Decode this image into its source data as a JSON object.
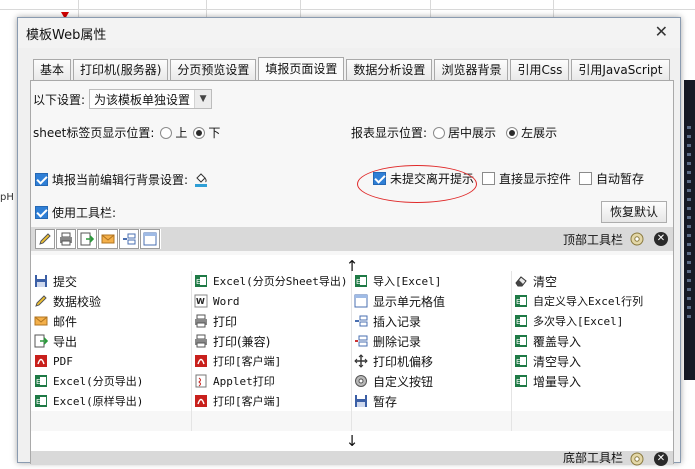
{
  "background": {
    "cell_mark": "pH ·"
  },
  "dialog": {
    "title": "模板Web属性",
    "close_label": "✕",
    "tabs": [
      {
        "label": "基本"
      },
      {
        "label": "打印机(服务器)"
      },
      {
        "label": "分页预览设置"
      },
      {
        "label": "填报页面设置",
        "active": true
      },
      {
        "label": "数据分析设置"
      },
      {
        "label": "浏览器背景"
      },
      {
        "label": "引用Css"
      },
      {
        "label": "引用JavaScript"
      }
    ]
  },
  "settings": {
    "scope_label": "以下设置:",
    "scope_value": "为该模板单独设置",
    "sheet_tab_label": "sheet标签页显示位置:",
    "sheet_opt_top": "上",
    "sheet_opt_bottom": "下",
    "report_pos_label": "报表显示位置:",
    "report_opt_center": "居中展示",
    "report_opt_left": "左展示",
    "fill_row_bg_label": "填报当前编辑行背景设置:",
    "unsubmitted_label": "未提交离开提示",
    "direct_show_label": "直接显示控件",
    "auto_save_label": "自动暂存",
    "use_toolbar_label": "使用工具栏:",
    "restore_default_label": "恢复默认"
  },
  "toolbar_top": {
    "label": "顶部工具栏"
  },
  "toolbar_bottom": {
    "label": "底部工具栏"
  },
  "arrow_up": "↑",
  "arrow_down": "↓",
  "buttons": [
    [
      "提交",
      "Excel(分页分Sheet导出)",
      "导入[Excel]",
      "清空"
    ],
    [
      "数据校验",
      "Word",
      "显示单元格值",
      "自定义导入Excel行列"
    ],
    [
      "邮件",
      "打印",
      "插入记录",
      "多次导入[Excel]"
    ],
    [
      "导出",
      "打印(兼容)",
      "删除记录",
      "覆盖导入"
    ],
    [
      "PDF",
      "打印[客户端]",
      "打印机偏移",
      "清空导入"
    ],
    [
      "Excel(分页导出)",
      "Applet打印",
      "自定义按钮",
      "增量导入"
    ],
    [
      "Excel(原样导出)",
      "打印[客户端]",
      "暂存",
      ""
    ]
  ],
  "icons": [
    [
      "save-icon",
      "excel-icon",
      "excel-icon",
      "eraser-icon"
    ],
    [
      "pencil-icon",
      "word-icon",
      "cell-icon",
      "excel-icon"
    ],
    [
      "mail-icon",
      "printer-icon",
      "insert-row-icon",
      "excel-icon"
    ],
    [
      "export-icon",
      "printer-icon",
      "delete-row-icon",
      "excel-icon"
    ],
    [
      "pdf-icon",
      "pdf-icon",
      "move-icon",
      "excel-icon"
    ],
    [
      "excel-icon",
      "applet-icon",
      "gear-icon",
      "excel-icon"
    ],
    [
      "excel-icon",
      "pdf-icon",
      "save-icon",
      ""
    ]
  ],
  "colors": {
    "accent": "#2f7fd6",
    "circle": "#e02a2a",
    "excel": "#1f7a46",
    "pdf": "#c8201c"
  }
}
